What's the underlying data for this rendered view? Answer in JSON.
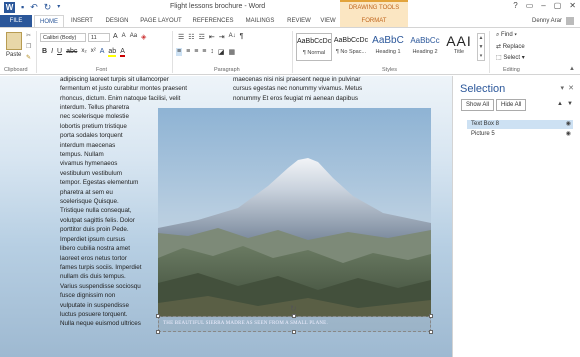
{
  "titlebar": {
    "title": "Flight lessons brochure - Word",
    "drawing_tools": "DRAWING TOOLS",
    "app_icon": "W",
    "window_controls": [
      "?",
      "▭",
      "–",
      "▢",
      "✕"
    ]
  },
  "tabs": {
    "file": "FILE",
    "items": [
      "HOME",
      "INSERT",
      "DESIGN",
      "PAGE LAYOUT",
      "REFERENCES",
      "MAILINGS",
      "REVIEW",
      "VIEW"
    ],
    "format": "FORMAT",
    "user": "Denny Arar"
  },
  "ribbon": {
    "clipboard": {
      "paste": "Paste",
      "label": "Clipboard"
    },
    "font": {
      "name": "Calibri (Body)",
      "size": "11",
      "label": "Font"
    },
    "paragraph": {
      "label": "Paragraph"
    },
    "styles": {
      "label": "Styles",
      "items": [
        {
          "preview": "AaBbCcDc",
          "name": "¶ Normal"
        },
        {
          "preview": "AaBbCcDc",
          "name": "¶ No Spac..."
        },
        {
          "preview": "AaBbC",
          "name": "Heading 1"
        },
        {
          "preview": "AaBbCc",
          "name": "Heading 2"
        },
        {
          "preview": "AAI",
          "name": "Title"
        }
      ]
    },
    "editing": {
      "find": "Find",
      "replace": "Replace",
      "select": "Select",
      "label": "Editing"
    }
  },
  "document": {
    "top_line_left": "adipiscing laoreet turpis sit ullamcorper",
    "left_top_lines": [
      "fermentum et justo curabitur montes praesent",
      "rhoncus, dictum. Enim natoque facilisi, velit"
    ],
    "left_lines": [
      "interdum. Tellus pharetra",
      "nec scelerisque molestie",
      "lobortis pretium tristique",
      "porta sodales torquent",
      "interdum maecenas",
      "tempus. Nullam",
      "vivamus hymenaeos",
      "vestibulum vestibulum",
      "tempor. Egestas elementum",
      "pharetra at sem eu",
      "scelerisque Quisque.",
      "Tristique nulla consequat,",
      "volutpat sagittis felis. Dolor",
      "porttitor duis proin Pede.",
      "Imperdiet ipsum cursus",
      "libero cubilia nostra amet",
      "laoreet eros netus tortor",
      "fames turpis sociis. Imperdiet",
      "nullam dis duis tempus.",
      "Varius suspendisse sociosqu",
      "fusce dignissim non",
      "vulputate in suspendisse",
      "luctus posuere torquent.",
      "Nulla neque euismod ultrices"
    ],
    "right_lines": [
      "maecenas nisi nisi praesent neque in pulvinar",
      "cursus egestas nec nonummy vivamus. Metus",
      "nonummy Et eros feugiat mi aenean dapibus"
    ],
    "caption": "THE BEAUTIFUL SIERRA MADRE AS SEEN FROM A SMALL PLANE."
  },
  "selection_pane": {
    "title": "Selection",
    "show_all": "Show All",
    "hide_all": "Hide All",
    "items": [
      {
        "name": "Text Box 8",
        "selected": true
      },
      {
        "name": "Picture 5",
        "selected": false
      }
    ]
  }
}
